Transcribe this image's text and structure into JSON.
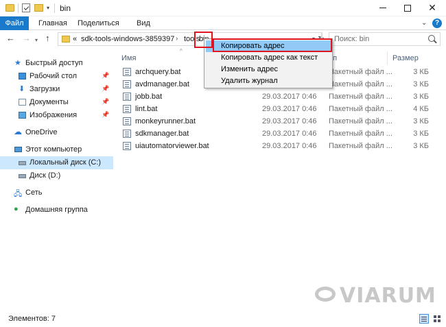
{
  "window": {
    "title": "bin",
    "minimize_glyph": "",
    "close_glyph": "✕"
  },
  "ribbon": {
    "tabs": [
      {
        "label": "Файл"
      },
      {
        "label": "Главная"
      },
      {
        "label": "Поделиться"
      },
      {
        "label": "Вид"
      }
    ],
    "help_glyph": "?"
  },
  "address": {
    "prefix": "«",
    "segments": [
      "sdk-tools-windows-3859397",
      "tools",
      "bin"
    ],
    "search_placeholder": "Поиск: bin"
  },
  "sidebar": {
    "items": [
      {
        "label": "Быстрый доступ",
        "icon": "star-icon"
      },
      {
        "label": "Рабочий стол",
        "icon": "desktop-icon",
        "pinned": true
      },
      {
        "label": "Загрузки",
        "icon": "download-icon",
        "pinned": true
      },
      {
        "label": "Документы",
        "icon": "documents-icon",
        "pinned": true
      },
      {
        "label": "Изображения",
        "icon": "pictures-icon",
        "pinned": true
      },
      {
        "label": "OneDrive",
        "icon": "cloud-icon"
      },
      {
        "label": "Этот компьютер",
        "icon": "computer-icon"
      },
      {
        "label": "Локальный диск (C:)",
        "icon": "disk-icon",
        "selected": true
      },
      {
        "label": "Диск (D:)",
        "icon": "disk-icon"
      },
      {
        "label": "Сеть",
        "icon": "network-icon"
      },
      {
        "label": "Домашняя группа",
        "icon": "homegroup-icon"
      }
    ]
  },
  "columns": {
    "name": "Имя",
    "type_partial": "ип",
    "size": "Размер"
  },
  "files": [
    {
      "name": "archquery.bat",
      "date": "",
      "type": "Пакетный файл ...",
      "size": "3 КБ"
    },
    {
      "name": "avdmanager.bat",
      "date": "",
      "type": "Пакетный файл ...",
      "size": "3 КБ"
    },
    {
      "name": "jobb.bat",
      "date": "29.03.2017 0:46",
      "type": "Пакетный файл ...",
      "size": "3 КБ"
    },
    {
      "name": "lint.bat",
      "date": "29.03.2017 0:46",
      "type": "Пакетный файл ...",
      "size": "4 КБ"
    },
    {
      "name": "monkeyrunner.bat",
      "date": "29.03.2017 0:46",
      "type": "Пакетный файл ...",
      "size": "3 КБ"
    },
    {
      "name": "sdkmanager.bat",
      "date": "29.03.2017 0:46",
      "type": "Пакетный файл ...",
      "size": "3 КБ"
    },
    {
      "name": "uiautomatorviewer.bat",
      "date": "29.03.2017 0:46",
      "type": "Пакетный файл ...",
      "size": "3 КБ"
    }
  ],
  "context_menu": {
    "items": [
      {
        "label": "Копировать адрес",
        "highlighted": true
      },
      {
        "label": "Копировать адрес как текст"
      },
      {
        "label": "Изменить адрес"
      },
      {
        "label": "Удалить журнал"
      }
    ]
  },
  "status": {
    "items_count": "Элементов: 7"
  },
  "watermark": {
    "text": "VIARUM"
  },
  "colors": {
    "accent": "#1979ca",
    "selection": "#cce8ff",
    "menu_highlight": "#91c9f7",
    "annotation_red": "#e0141e"
  }
}
